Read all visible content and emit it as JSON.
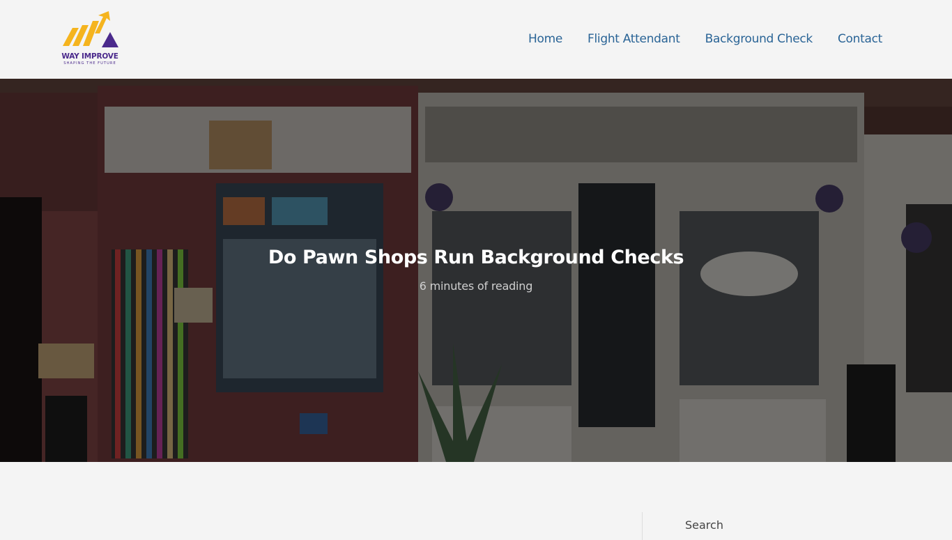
{
  "logo": {
    "name": "WAY IMPROVE",
    "tagline": "SHAPING THE FUTURE",
    "colors": {
      "yellow": "#f5b41e",
      "purple": "#4b2a8c"
    }
  },
  "nav": {
    "items": [
      {
        "label": "Home"
      },
      {
        "label": "Flight Attendant"
      },
      {
        "label": "Background Check"
      },
      {
        "label": "Contact"
      }
    ]
  },
  "hero": {
    "title": "Do Pawn Shops Run Background Checks",
    "meta": "6 minutes of reading"
  },
  "sidebar": {
    "search_label": "Search"
  },
  "colors": {
    "nav_link": "#2a6496",
    "page_bg": "#f4f4f4"
  }
}
